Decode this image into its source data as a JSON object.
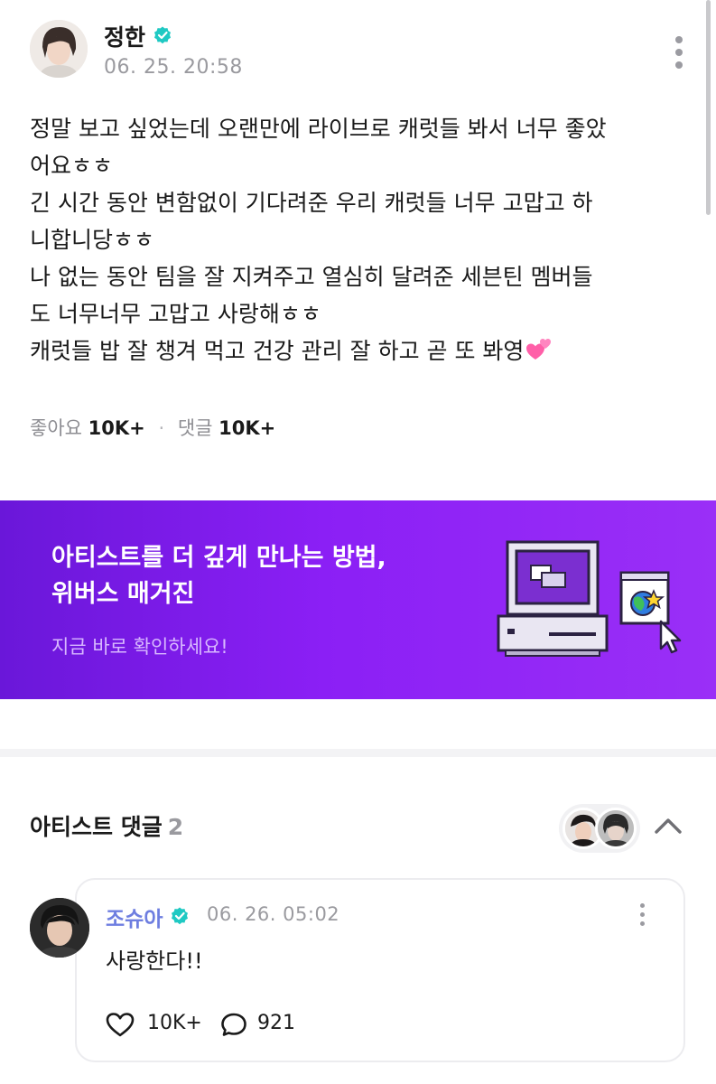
{
  "post": {
    "author": "정한",
    "timestamp": "06. 25. 20:58",
    "body_lines": [
      "정말 보고 싶었는데 오랜만에 라이브로 캐럿들 봐서 너무 좋았",
      "어요ㅎㅎ",
      "긴 시간 동안 변함없이 기다려준 우리 캐럿들 너무 고맙고 하",
      "니합니당ㅎㅎ",
      "나 없는 동안 팀을 잘 지켜주고 열심히 달려준 세븐틴 멤버들",
      "도 너무너무 고맙고 사랑해ㅎㅎ",
      "캐럿들 밥 잘 챙겨 먹고 건강 관리 잘 하고 곧 또 봐영"
    ],
    "emoji": "two-hearts",
    "likes_label": "좋아요",
    "likes_count": "10K+",
    "comments_label": "댓글",
    "comments_count": "10K+"
  },
  "banner": {
    "title": "아티스트를 더 깊게 만나는 방법,\n위버스 매거진",
    "subtitle": "지금 바로 확인하세요!",
    "colors": {
      "start": "#6a17d9",
      "end": "#9a2ff7"
    }
  },
  "artist_comments": {
    "title": "아티스트 댓글",
    "count": "2",
    "comment": {
      "author": "조슈아",
      "timestamp": "06. 26. 05:02",
      "text": "사랑한다!!",
      "likes": "10K+",
      "replies": "921"
    }
  },
  "colors": {
    "verified": "#1fc9c3",
    "accent_name": "#6e7ee0",
    "muted": "#9a9a9f"
  }
}
